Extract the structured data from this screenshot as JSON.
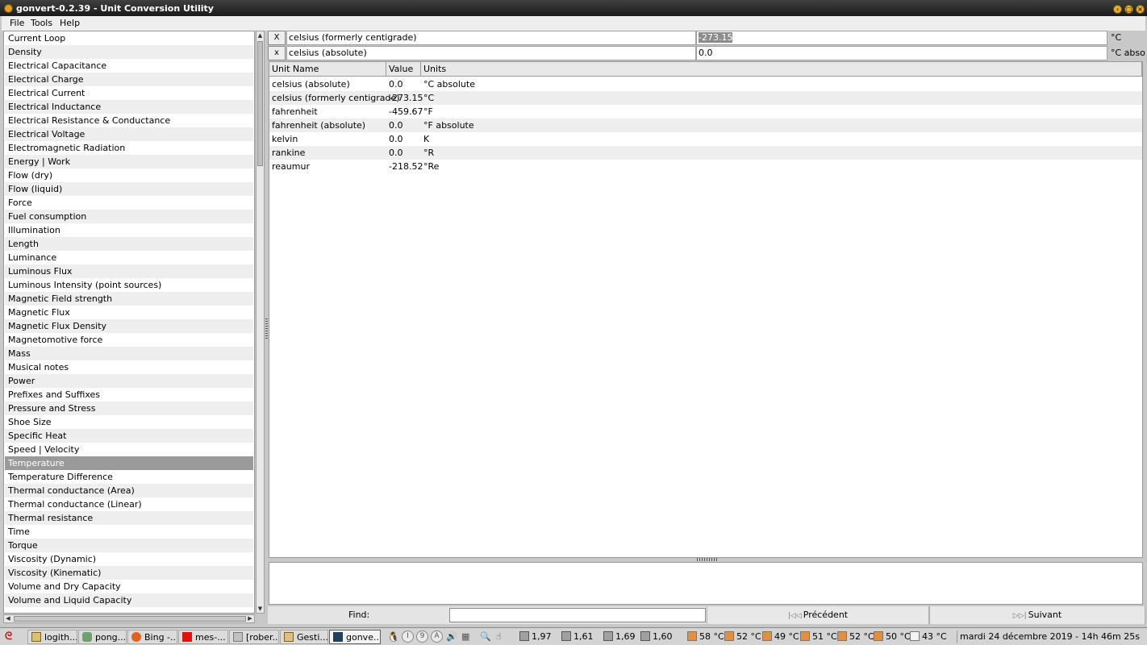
{
  "window": {
    "title": "gonvert-0.2.39 - Unit Conversion Utility"
  },
  "menu": [
    "File",
    "Tools",
    "Help"
  ],
  "categories": [
    "Current Loop",
    "Density",
    "Electrical Capacitance",
    "Electrical Charge",
    "Electrical Current",
    "Electrical Inductance",
    "Electrical Resistance & Conductance",
    "Electrical Voltage",
    "Electromagnetic Radiation",
    "Energy | Work",
    "Flow (dry)",
    "Flow (liquid)",
    "Force",
    "Fuel consumption",
    "Illumination",
    "Length",
    "Luminance",
    "Luminous Flux",
    "Luminous Intensity (point sources)",
    "Magnetic Field strength",
    "Magnetic Flux",
    "Magnetic Flux Density",
    "Magnetomotive force",
    "Mass",
    "Musical notes",
    "Power",
    "Prefixes and Suffixes",
    "Pressure and Stress",
    "Shoe Size",
    "Specific Heat",
    "Speed | Velocity",
    "Temperature",
    "Temperature Difference",
    "Thermal conductance (Area)",
    "Thermal conductance (Linear)",
    "Thermal resistance",
    "Time",
    "Torque",
    "Viscosity (Dynamic)",
    "Viscosity (Kinematic)",
    "Volume and Dry Capacity",
    "Volume and Liquid Capacity"
  ],
  "selected_category": "Temperature",
  "conversions": [
    {
      "clear": "X",
      "unit_name": "celsius (formerly centigrade)",
      "value": "-273.15",
      "unit": "°C"
    },
    {
      "clear": "x",
      "unit_name": "celsius (absolute)",
      "value": "0.0",
      "unit": "°C absolu"
    }
  ],
  "table": {
    "headers": [
      "Unit Name",
      "Value",
      "Units"
    ],
    "rows": [
      [
        "celsius (absolute)",
        "0.0",
        "°C absolute"
      ],
      [
        "celsius (formerly centigrade)",
        "-273.15",
        "°C"
      ],
      [
        "fahrenheit",
        "-459.67",
        "°F"
      ],
      [
        "fahrenheit (absolute)",
        "0.0",
        "°F absolute"
      ],
      [
        "kelvin",
        "0.0",
        "K"
      ],
      [
        "rankine",
        "0.0",
        "°R"
      ],
      [
        "reaumur",
        "-218.52",
        "°Re"
      ]
    ]
  },
  "find": {
    "label": "Find:",
    "prev": "Précédent",
    "next": "Suivant"
  },
  "taskbar": {
    "windows": [
      "logith...",
      "pong...",
      "Bing -...",
      "mes-...",
      "[rober...",
      "Gesti...",
      "gonve..."
    ],
    "tray_letters": [
      "I",
      "9",
      "A"
    ],
    "loads": [
      "1,97",
      "1,61",
      "1,69",
      "1,60"
    ],
    "temps": [
      "58 °C",
      "52 °C",
      "49 °C",
      "51 °C",
      "52 °C",
      "50 °C",
      "43 °C"
    ],
    "clock": "mardi 24 décembre 2019 - 14h 46m 25s"
  },
  "colors": {
    "selection": "#9a9a9a",
    "titlebar": "#2a2a2a",
    "alt_row": "#eeeeee"
  }
}
